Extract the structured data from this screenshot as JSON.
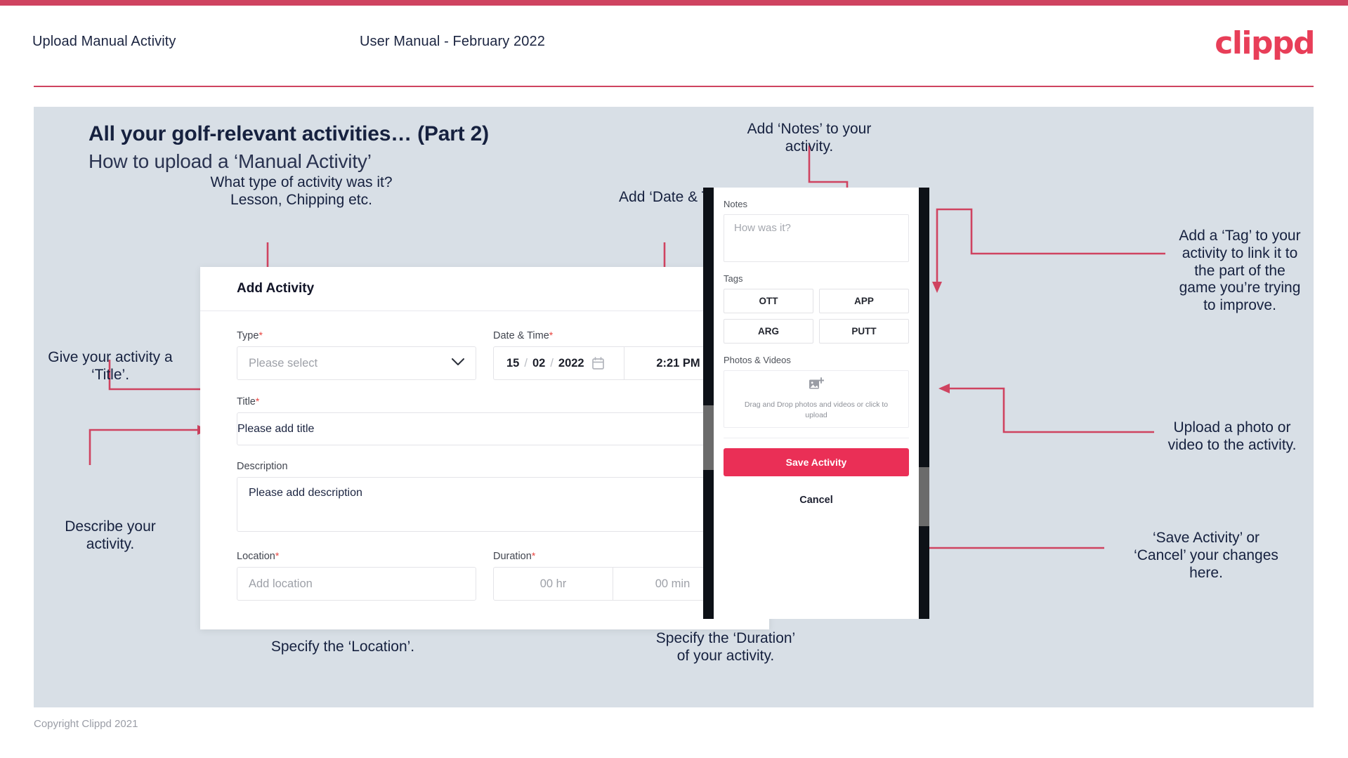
{
  "header": {
    "title": "Upload Manual Activity",
    "subtitle": "User Manual - February 2022",
    "logo": "clippd"
  },
  "slide": {
    "title": "All your golf-relevant activities… (Part 2)",
    "subtitle": "How to upload a ‘Manual Activity’"
  },
  "callouts": {
    "type": "What type of activity was it?\nLesson, Chipping etc.",
    "date_time": "Add ‘Date & Time’.",
    "title_field": "Give your activity a\n‘Title’.",
    "description": "Describe your\nactivity.",
    "location": "Specify the ‘Location’.",
    "duration": "Specify the ‘Duration’\nof your activity.",
    "notes": "Add ‘Notes’ to your\nactivity.",
    "tags": "Add a ‘Tag’ to your\nactivity to link it to\nthe part of the\ngame you’re trying\nto improve.",
    "upload": "Upload a photo or\nvideo to the activity.",
    "save_cancel": "‘Save Activity’ or\n‘Cancel’ your changes\nhere."
  },
  "modal": {
    "title": "Add Activity",
    "close_icon": "close-icon",
    "fields": {
      "type": {
        "label": "Type",
        "required": "*",
        "placeholder": "Please select"
      },
      "datetime": {
        "label": "Date & Time",
        "required": "*",
        "day": "15",
        "month": "02",
        "year": "2022",
        "separator": "/",
        "time": "2:21 PM"
      },
      "title": {
        "label": "Title",
        "required": "*",
        "placeholder": "Please add title"
      },
      "description": {
        "label": "Description",
        "placeholder": "Please add description"
      },
      "location": {
        "label": "Location",
        "required": "*",
        "placeholder": "Add location"
      },
      "duration": {
        "label": "Duration",
        "required": "*",
        "hours_placeholder": "00 hr",
        "minutes_placeholder": "00 min"
      }
    }
  },
  "phone": {
    "notes": {
      "label": "Notes",
      "placeholder": "How was it?"
    },
    "tags": {
      "label": "Tags",
      "options": [
        "OTT",
        "APP",
        "ARG",
        "PUTT"
      ]
    },
    "photos": {
      "label": "Photos & Videos",
      "drop_text": "Drag and Drop photos and videos or click to upload",
      "icon": "add-image-icon"
    },
    "save_label": "Save Activity",
    "cancel_label": "Cancel"
  },
  "footer": {
    "copyright": "Copyright Clippd 2021"
  },
  "colors": {
    "accent": "#e83e58",
    "save_button": "#ea2f56",
    "slide_bg": "#d8dfe6",
    "arrow": "#cf4360",
    "title_text": "#16213f"
  }
}
